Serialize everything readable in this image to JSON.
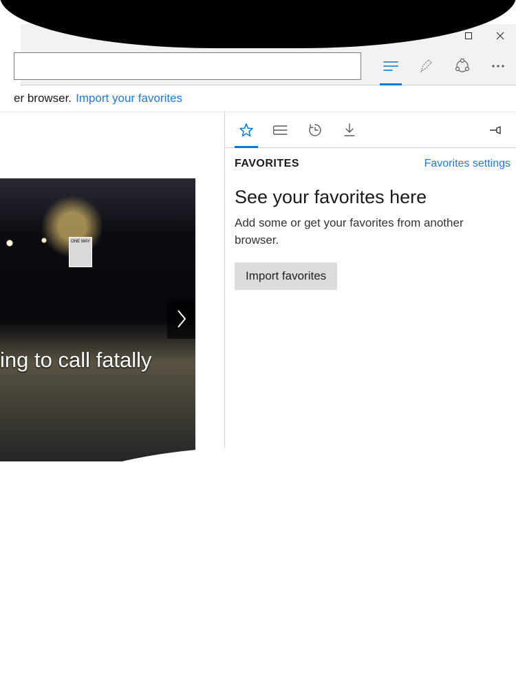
{
  "infobar": {
    "prefix_fragment": "er browser.",
    "link": "Import your favorites"
  },
  "tile": {
    "sign_text": "ONE WAY",
    "headline_fragment": "ing to call fatally"
  },
  "hub": {
    "title": "FAVORITES",
    "settings_link": "Favorites settings",
    "empty_heading": "See your favorites here",
    "empty_body": "Add some or get your favorites from another browser.",
    "import_button": "Import favorites"
  }
}
